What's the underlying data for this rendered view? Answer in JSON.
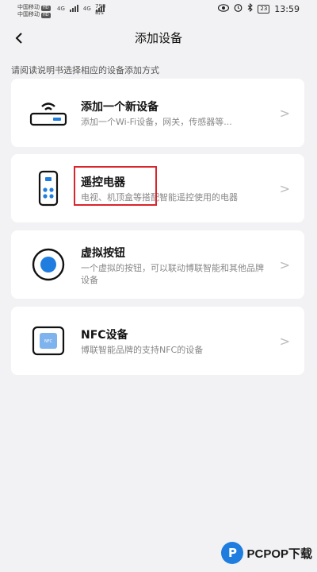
{
  "status_bar": {
    "carrier1": "中国移动",
    "carrier2": "中国移动",
    "carrier_tag": "HD",
    "network": "4G",
    "speed_value": "798",
    "speed_unit": "B/s",
    "battery": "23",
    "time": "13:59"
  },
  "header": {
    "title": "添加设备",
    "back_symbol": "<"
  },
  "hint": "请阅读说明书选择相应的设备添加方式",
  "cards": [
    {
      "title": "添加一个新设备",
      "desc": "添加一个Wi-Fi设备，网关，传感器等..."
    },
    {
      "title": "遥控电器",
      "desc": "电视、机顶盒等搭配智能遥控使用的电器"
    },
    {
      "title": "虚拟按钮",
      "desc": "一个虚拟的按钮，可以联动博联智能和其他品牌设备"
    },
    {
      "title": "NFC设备",
      "desc": "博联智能品牌的支持NFC的设备"
    }
  ],
  "chevron": ">",
  "nfc_icon_label": "NFC",
  "watermark": {
    "logo_letter": "P",
    "text": "PCPOP下载"
  },
  "colors": {
    "accent_blue": "#1f7de0",
    "highlight_red": "#d8262c",
    "background": "#f2f2f4"
  }
}
